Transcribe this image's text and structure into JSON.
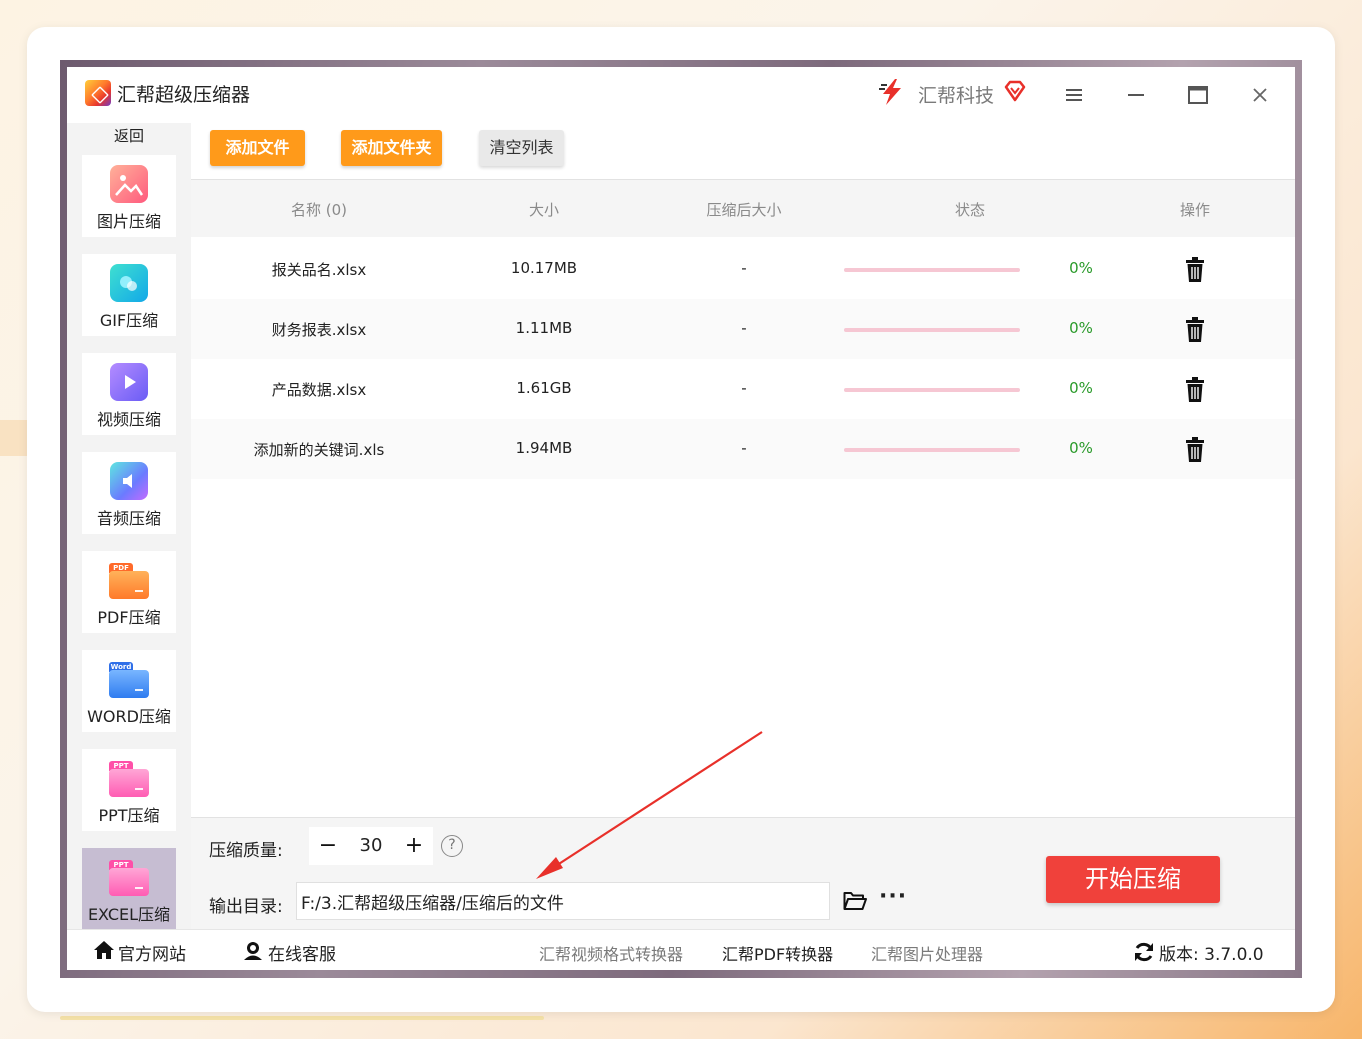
{
  "app": {
    "title": "汇帮超级压缩器",
    "brand": "汇帮科技"
  },
  "window_controls": {
    "menu_icon": "hamburger-icon",
    "minimize_icon": "minimize-icon",
    "maximize_icon": "maximize-icon",
    "close_icon": "close-icon"
  },
  "sidebar": {
    "back_label": "返回",
    "items": [
      {
        "label": "图片压缩",
        "icon": "image-icon"
      },
      {
        "label": "GIF压缩",
        "icon": "gif-icon"
      },
      {
        "label": "视频压缩",
        "icon": "video-play-icon"
      },
      {
        "label": "音频压缩",
        "icon": "audio-speaker-icon"
      },
      {
        "label": "PDF压缩",
        "icon": "pdf-folder-icon",
        "badge": "PDF"
      },
      {
        "label": "WORD压缩",
        "icon": "word-folder-icon",
        "badge": "Word"
      },
      {
        "label": "PPT压缩",
        "icon": "ppt-folder-icon",
        "badge": "PPT"
      },
      {
        "label": "EXCEL压缩",
        "icon": "excel-folder-icon",
        "badge": "PPT",
        "active": true
      }
    ]
  },
  "toolbar": {
    "add_file": "添加文件",
    "add_folder": "添加文件夹",
    "clear_list": "清空列表"
  },
  "table": {
    "headers": {
      "name": "名称 (0)",
      "size": "大小",
      "compressed_size": "压缩后大小",
      "status": "状态",
      "action": "操作"
    },
    "rows": [
      {
        "name": "报关品名.xlsx",
        "size": "10.17MB",
        "compressed": "-",
        "progress": 0,
        "percent": "0%"
      },
      {
        "name": "财务报表.xlsx",
        "size": "1.11MB",
        "compressed": "-",
        "progress": 0,
        "percent": "0%"
      },
      {
        "name": "产品数据.xlsx",
        "size": "1.61GB",
        "compressed": "-",
        "progress": 0,
        "percent": "0%"
      },
      {
        "name": "添加新的关键词.xls",
        "size": "1.94MB",
        "compressed": "-",
        "progress": 0,
        "percent": "0%"
      }
    ]
  },
  "settings": {
    "quality_label": "压缩质量:",
    "quality_value": "30",
    "minus": "−",
    "plus": "+",
    "help": "?",
    "output_label": "输出目录:",
    "output_path": "F:/3.汇帮超级压缩器/压缩后的文件",
    "more": "···",
    "start": "开始压缩"
  },
  "footer": {
    "website": "官方网站",
    "support": "在线客服",
    "links": [
      "汇帮视频格式转换器",
      "汇帮PDF转换器",
      "汇帮图片处理器"
    ],
    "version": "版本: 3.7.0.0"
  },
  "colors": {
    "accent_orange": "#ff9a1a",
    "start_red": "#f0413b",
    "progress_pink": "#f6c7d3",
    "percent_green": "#2a9a2a",
    "annotation_arrow": "#e8302a"
  }
}
